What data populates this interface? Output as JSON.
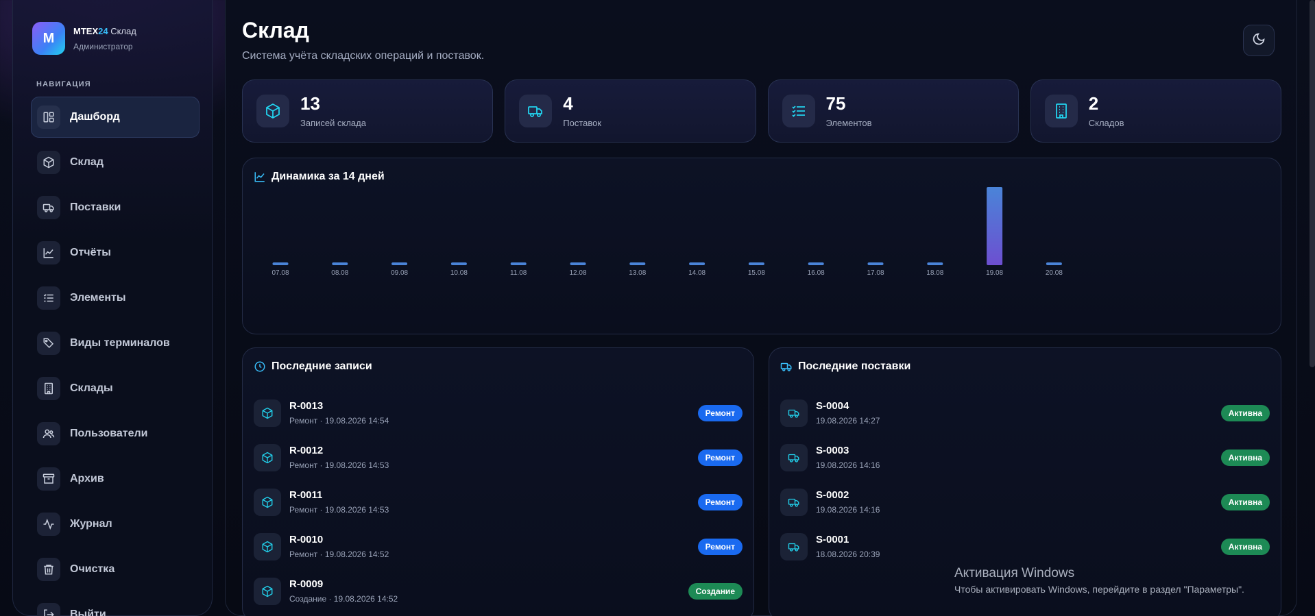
{
  "brand": {
    "logo_letter": "M",
    "name_main": "MTEX",
    "name_accent": "24",
    "name_suffix": " Склад",
    "role": "Администратор"
  },
  "nav": {
    "section_label": "НАВИГАЦИЯ",
    "items": [
      {
        "label": "Дашборд",
        "icon": "dashboard-icon",
        "active": true
      },
      {
        "label": "Склад",
        "icon": "box-icon"
      },
      {
        "label": "Поставки",
        "icon": "truck-icon"
      },
      {
        "label": "Отчёты",
        "icon": "chart-icon"
      },
      {
        "label": "Элементы",
        "icon": "list-icon"
      },
      {
        "label": "Виды терминалов",
        "icon": "tag-icon"
      },
      {
        "label": "Склады",
        "icon": "building-icon"
      },
      {
        "label": "Пользователи",
        "icon": "users-icon"
      },
      {
        "label": "Архив",
        "icon": "archive-icon"
      },
      {
        "label": "Журнал",
        "icon": "activity-icon"
      },
      {
        "label": "Очистка",
        "icon": "trash-icon"
      },
      {
        "label": "Выйти",
        "icon": "logout-icon"
      }
    ]
  },
  "header": {
    "title": "Склад",
    "subtitle": "Система учёта складских операций и поставок.",
    "theme_icon": "moon-icon"
  },
  "stats": [
    {
      "value": "13",
      "label": "Записей склада",
      "icon": "box-icon"
    },
    {
      "value": "4",
      "label": "Поставок",
      "icon": "truck-icon"
    },
    {
      "value": "75",
      "label": "Элементов",
      "icon": "list-icon"
    },
    {
      "value": "2",
      "label": "Складов",
      "icon": "building-icon"
    }
  ],
  "chart_data": {
    "type": "bar",
    "title": "Динамика за 14 дней",
    "categories": [
      "07.08",
      "08.08",
      "09.08",
      "10.08",
      "11.08",
      "12.08",
      "13.08",
      "14.08",
      "15.08",
      "16.08",
      "17.08",
      "18.08",
      "19.08",
      "20.08"
    ],
    "values": [
      0,
      0,
      0,
      0,
      0,
      0,
      0,
      0,
      0,
      0,
      0,
      0,
      13,
      0
    ],
    "xlabel": "",
    "ylabel": "",
    "grid": false,
    "colors": {
      "bar_top": "#4a84d8",
      "bar_bottom": "#6d4fd0"
    }
  },
  "records": {
    "title": "Последние записи",
    "items": [
      {
        "id": "R-0013",
        "meta": "Ремонт · 19.08.2026 14:54",
        "badge": "Ремонт",
        "badge_color": "#1a6af0"
      },
      {
        "id": "R-0012",
        "meta": "Ремонт · 19.08.2026 14:53",
        "badge": "Ремонт",
        "badge_color": "#1a6af0"
      },
      {
        "id": "R-0011",
        "meta": "Ремонт · 19.08.2026 14:53",
        "badge": "Ремонт",
        "badge_color": "#1a6af0"
      },
      {
        "id": "R-0010",
        "meta": "Ремонт · 19.08.2026 14:52",
        "badge": "Ремонт",
        "badge_color": "#1a6af0"
      },
      {
        "id": "R-0009",
        "meta": "Создание · 19.08.2026 14:52",
        "badge": "Создание",
        "badge_color": "#1d8a55"
      }
    ]
  },
  "deliveries": {
    "title": "Последние поставки",
    "items": [
      {
        "id": "S-0004",
        "meta": "19.08.2026 14:27",
        "badge": "Активна",
        "badge_color": "#1d8a55"
      },
      {
        "id": "S-0003",
        "meta": "19.08.2026 14:16",
        "badge": "Активна",
        "badge_color": "#1d8a55"
      },
      {
        "id": "S-0002",
        "meta": "19.08.2026 14:16",
        "badge": "Активна",
        "badge_color": "#1d8a55"
      },
      {
        "id": "S-0001",
        "meta": "18.08.2026 20:39",
        "badge": "Активна",
        "badge_color": "#1d8a55"
      }
    ]
  },
  "watermark": {
    "title": "Активация Windows",
    "subtitle": "Чтобы активировать Windows, перейдите в раздел \"Параметры\"."
  }
}
